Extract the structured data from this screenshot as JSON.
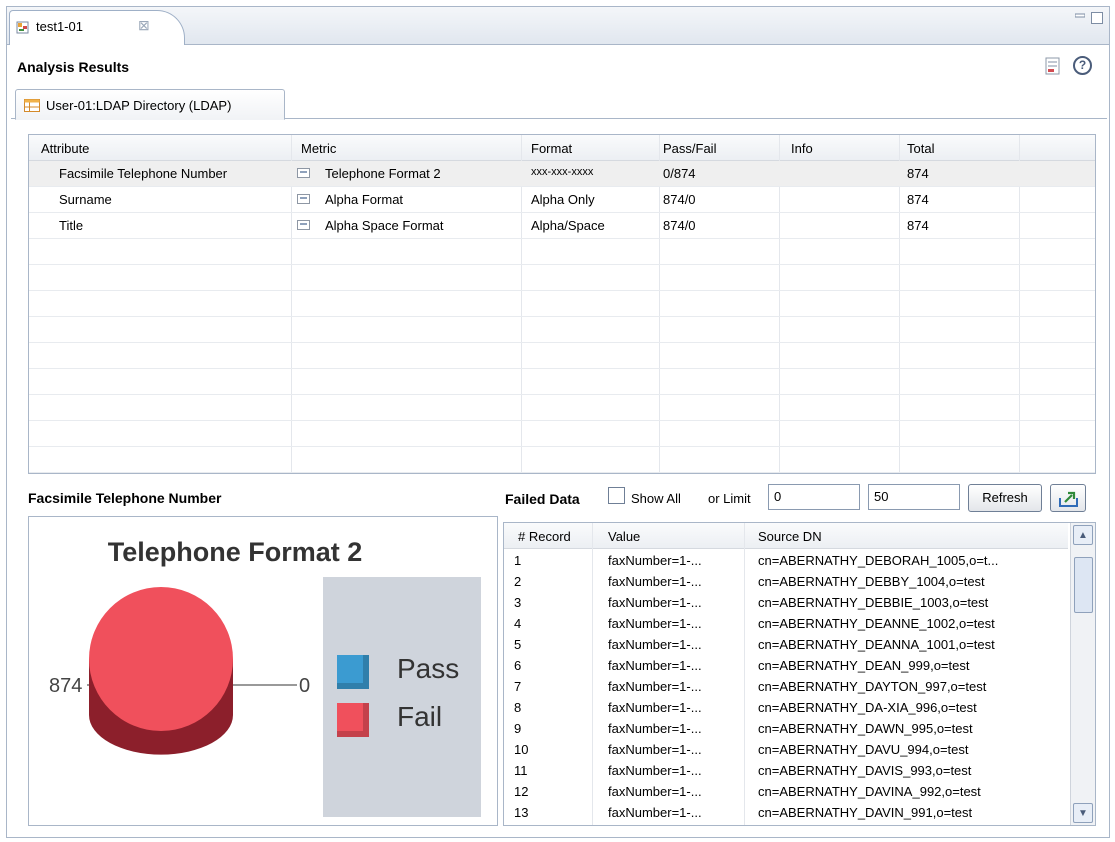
{
  "editor_tab": {
    "label": "test1-01",
    "close_symbol": "⊠"
  },
  "header": {
    "title": "Analysis Results",
    "help_symbol": "?"
  },
  "inner_tab": {
    "label": "User-01:LDAP Directory (LDAP)"
  },
  "metric_table": {
    "columns": [
      "Attribute",
      "Metric",
      "Format",
      "Pass/Fail",
      "Info",
      "Total"
    ],
    "rows": [
      {
        "attribute": "Facsimile Telephone Number",
        "metric": "Telephone Format 2",
        "format": "xxx-xxx-xxxx",
        "pass_fail": "0/874",
        "info": "",
        "total": "874",
        "selected": true
      },
      {
        "attribute": "Surname",
        "metric": "Alpha Format",
        "format": "Alpha Only",
        "pass_fail": "874/0",
        "info": "",
        "total": "874",
        "selected": false
      },
      {
        "attribute": "Title",
        "metric": "Alpha Space Format",
        "format": "Alpha/Space",
        "pass_fail": "874/0",
        "info": "",
        "total": "874",
        "selected": false
      }
    ]
  },
  "chart_panel": {
    "title": "Facsimile Telephone Number"
  },
  "chart_data": {
    "type": "pie",
    "title": "Telephone Format 2",
    "categories": [
      "Pass",
      "Fail"
    ],
    "values": [
      0,
      874
    ],
    "colors": {
      "Pass": "#3b9bd1",
      "Fail": "#f0505c"
    },
    "value_labels": {
      "left": "874",
      "right": "0"
    },
    "legend_position": "right"
  },
  "failed_data": {
    "label": "Failed Data",
    "show_all_label": "Show All",
    "show_all_checked": false,
    "or_limit_label": "or Limit",
    "limit_from": "0",
    "limit_to": "50",
    "refresh_label": "Refresh",
    "columns": [
      "# Record",
      "Value",
      "Source DN"
    ],
    "rows": [
      {
        "record": "1",
        "value": "faxNumber=1-...",
        "source_dn": "cn=ABERNATHY_DEBORAH_1005,o=t..."
      },
      {
        "record": "2",
        "value": "faxNumber=1-...",
        "source_dn": "cn=ABERNATHY_DEBBY_1004,o=test"
      },
      {
        "record": "3",
        "value": "faxNumber=1-...",
        "source_dn": "cn=ABERNATHY_DEBBIE_1003,o=test"
      },
      {
        "record": "4",
        "value": "faxNumber=1-...",
        "source_dn": "cn=ABERNATHY_DEANNE_1002,o=test"
      },
      {
        "record": "5",
        "value": "faxNumber=1-...",
        "source_dn": "cn=ABERNATHY_DEANNA_1001,o=test"
      },
      {
        "record": "6",
        "value": "faxNumber=1-...",
        "source_dn": "cn=ABERNATHY_DEAN_999,o=test"
      },
      {
        "record": "7",
        "value": "faxNumber=1-...",
        "source_dn": "cn=ABERNATHY_DAYTON_997,o=test"
      },
      {
        "record": "8",
        "value": "faxNumber=1-...",
        "source_dn": "cn=ABERNATHY_DA-XIA_996,o=test"
      },
      {
        "record": "9",
        "value": "faxNumber=1-...",
        "source_dn": "cn=ABERNATHY_DAWN_995,o=test"
      },
      {
        "record": "10",
        "value": "faxNumber=1-...",
        "source_dn": "cn=ABERNATHY_DAVU_994,o=test"
      },
      {
        "record": "11",
        "value": "faxNumber=1-...",
        "source_dn": "cn=ABERNATHY_DAVIS_993,o=test"
      },
      {
        "record": "12",
        "value": "faxNumber=1-...",
        "source_dn": "cn=ABERNATHY_DAVINA_992,o=test"
      },
      {
        "record": "13",
        "value": "faxNumber=1-...",
        "source_dn": "cn=ABERNATHY_DAVIN_991,o=test"
      }
    ]
  }
}
